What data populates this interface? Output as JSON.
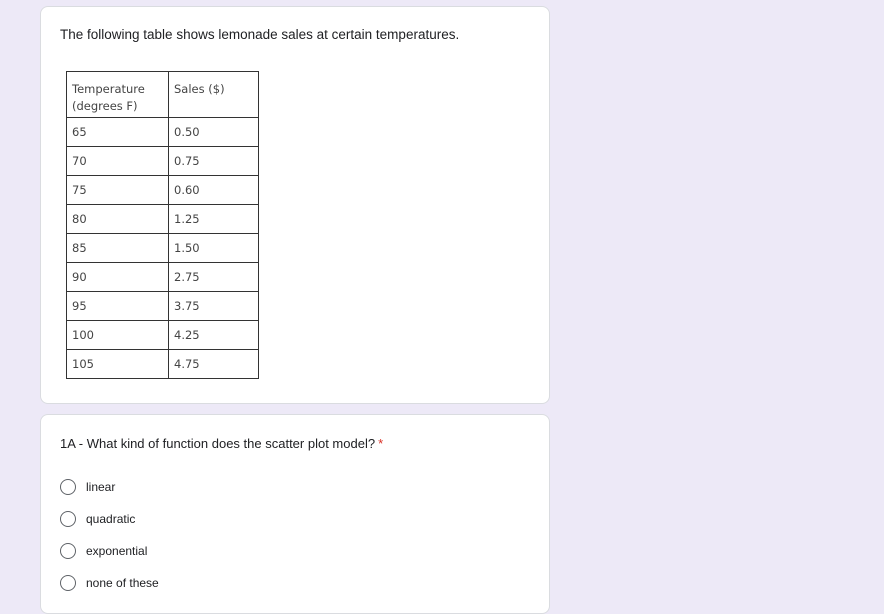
{
  "description_card": {
    "text": "The following table shows lemonade sales at certain temperatures.",
    "table": {
      "headers": [
        "Temperature (degrees F)",
        "Sales ($)"
      ],
      "header_lines": [
        [
          "Temperature",
          "(degrees F)"
        ],
        [
          "Sales ($)"
        ]
      ],
      "rows": [
        [
          "65",
          "0.50"
        ],
        [
          "70",
          "0.75"
        ],
        [
          "75",
          "0.60"
        ],
        [
          "80",
          "1.25"
        ],
        [
          "85",
          "1.50"
        ],
        [
          "90",
          "2.75"
        ],
        [
          "95",
          "3.75"
        ],
        [
          "100",
          "4.25"
        ],
        [
          "105",
          "4.75"
        ]
      ]
    }
  },
  "question_card": {
    "question": "1A - What kind of function does the scatter plot model?",
    "required_marker": "*",
    "options": [
      {
        "label": "linear",
        "selected": false
      },
      {
        "label": "quadratic",
        "selected": false
      },
      {
        "label": "exponential",
        "selected": false
      },
      {
        "label": "none of these",
        "selected": false
      }
    ]
  },
  "colors": {
    "page_background": "#ede9f7",
    "card_background": "#ffffff",
    "required_marker": "#d93025"
  }
}
